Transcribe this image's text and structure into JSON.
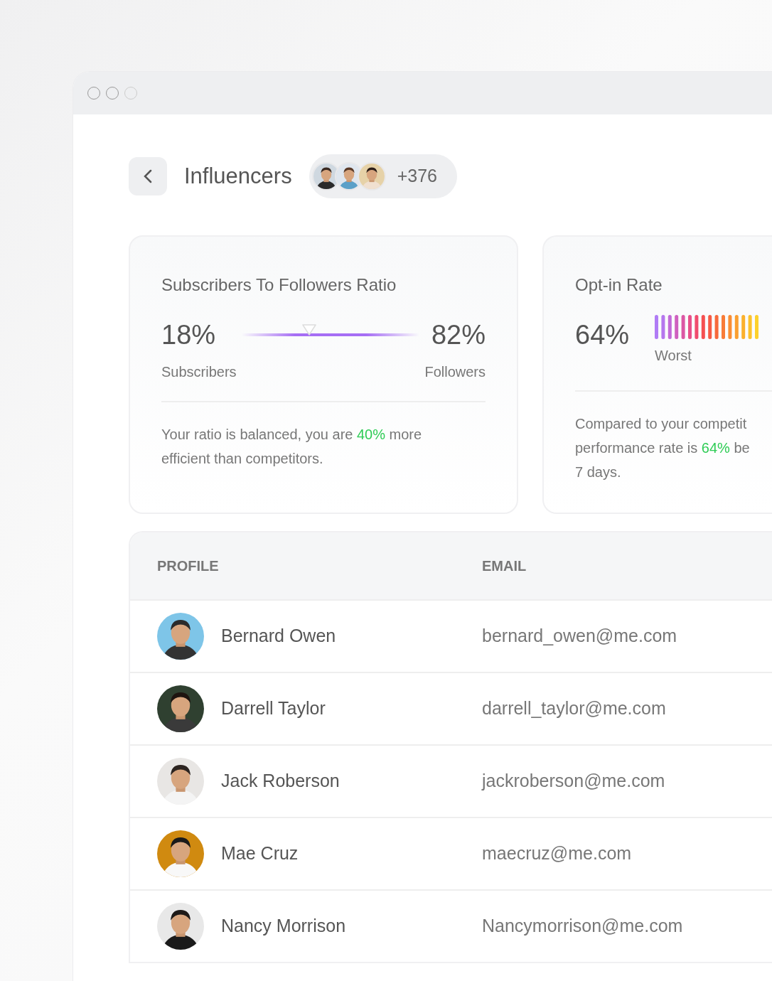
{
  "header": {
    "title": "Influencers",
    "avatar_count": "+376"
  },
  "cards": [
    {
      "kind": "ratio",
      "title": "Subscribers To Followers Ratio",
      "left_value": "18%",
      "left_label": "Subscribers",
      "right_value": "82%",
      "right_label": "Followers",
      "level": 0.38,
      "description": "Your ratio is balanced, you are **40%** more\nefficient than competitors."
    },
    {
      "kind": "meter",
      "title": "Opt-in Rate",
      "value": "64%",
      "meter_label": "Worst",
      "description": "Compared to your competit\nperformance rate is **64%** be\n7 days."
    }
  ],
  "table": {
    "columns": [
      "PROFILE",
      "EMAIL"
    ],
    "rows": [
      {
        "name": "Bernard Owen",
        "email": "bernard_owen@me.com"
      },
      {
        "name": "Darrell Taylor",
        "email": "darrell_taylor@me.com"
      },
      {
        "name": "Jack Roberson",
        "email": "jackroberson@me.com"
      },
      {
        "name": "Mae Cruz",
        "email": "maecruz@me.com"
      },
      {
        "name": "Nancy Morrison",
        "email": "Nancymorrison@me.com"
      }
    ]
  }
}
